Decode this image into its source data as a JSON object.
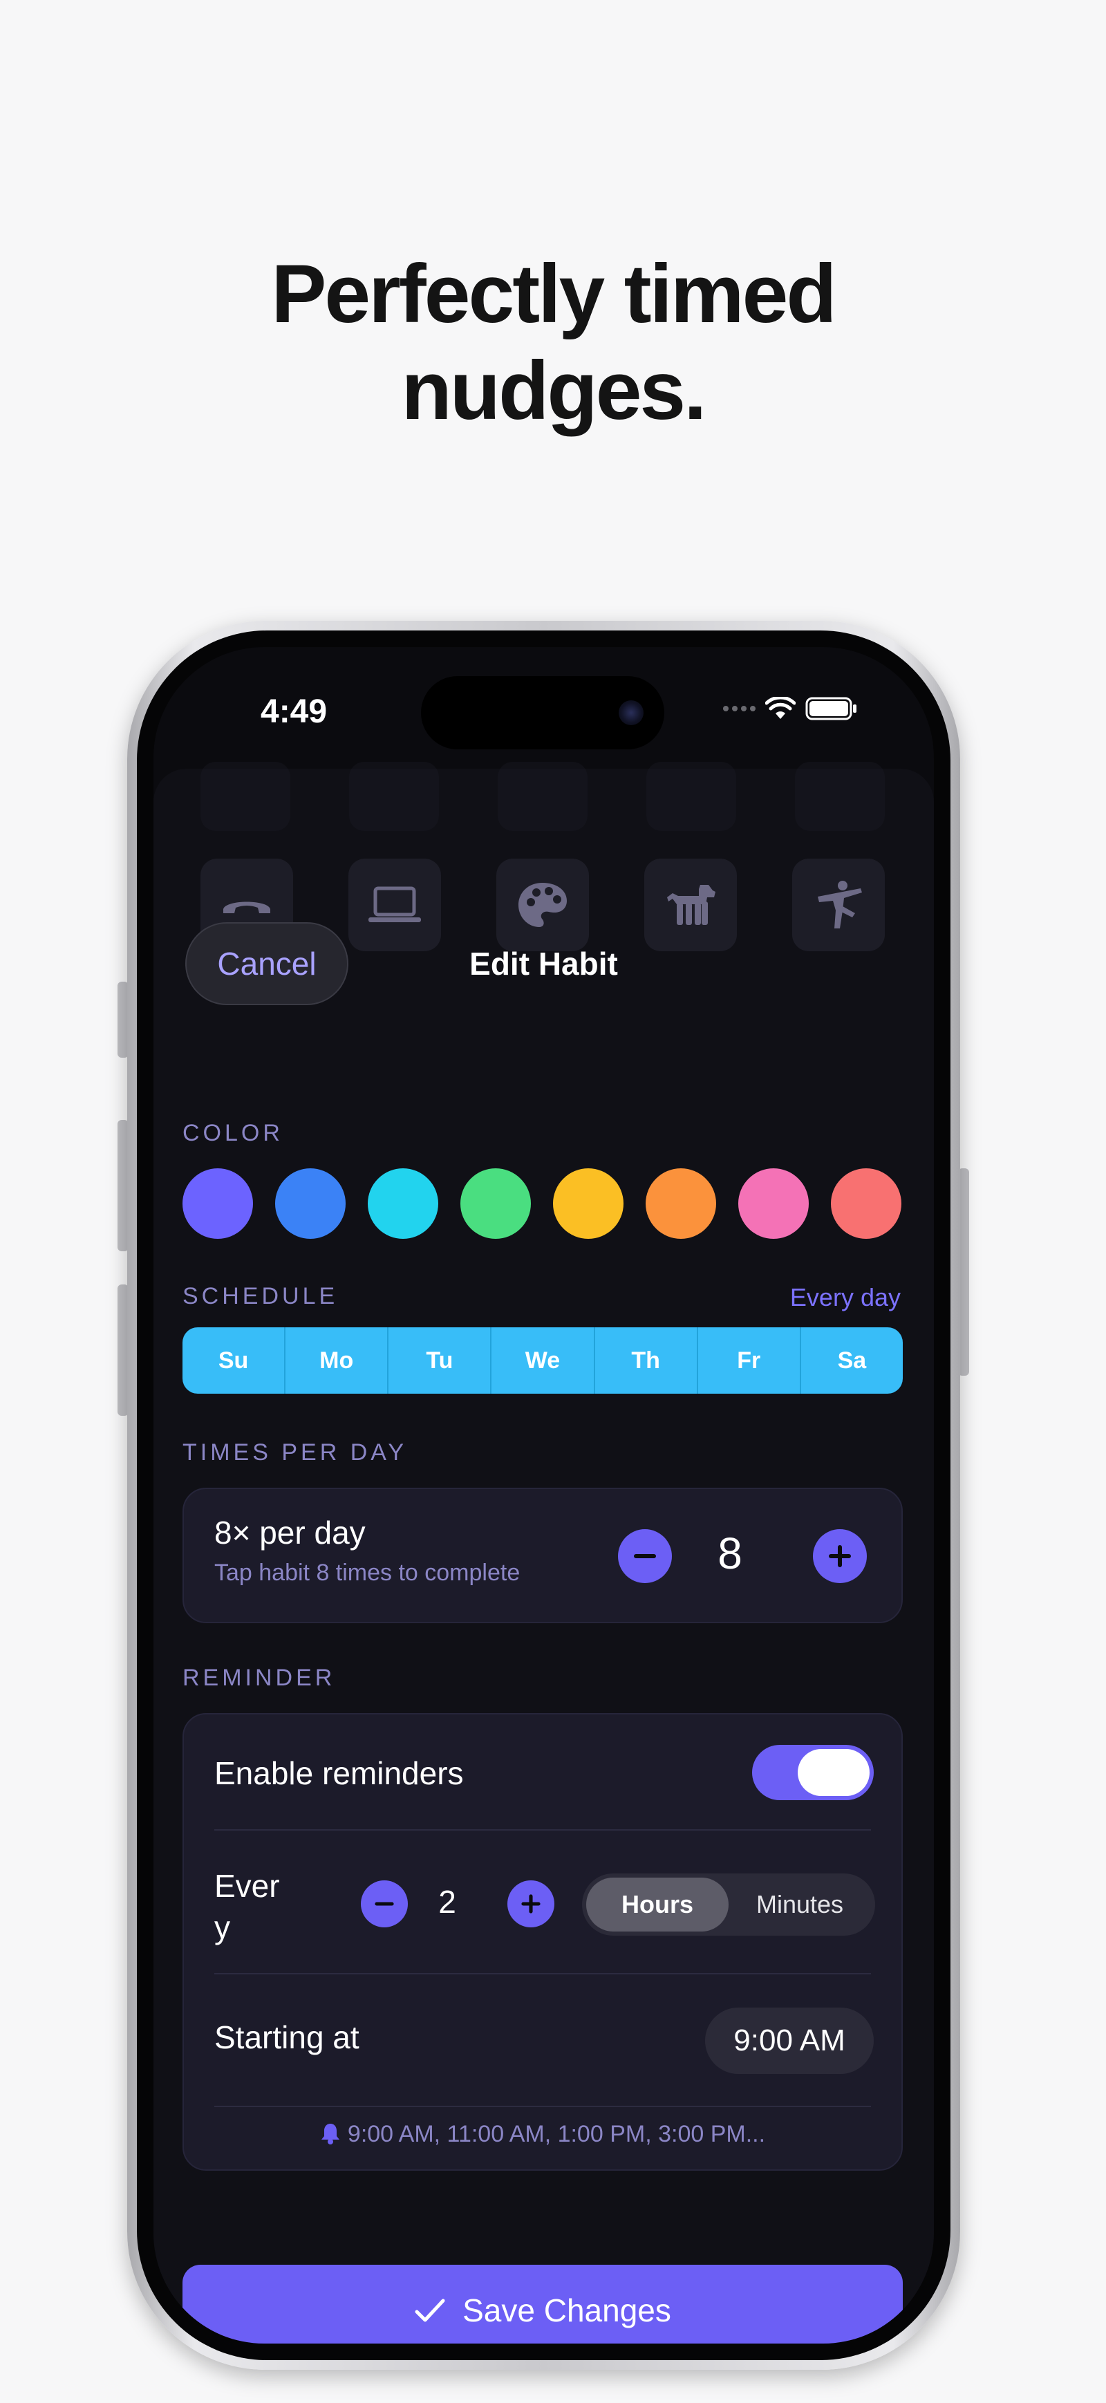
{
  "headline": {
    "line1": "Perfectly timed",
    "line2": "nudges."
  },
  "status_bar": {
    "time": "4:49"
  },
  "nav": {
    "cancel_label": "Cancel",
    "title": "Edit Habit"
  },
  "icons": [
    "phone-icon",
    "laptop-icon",
    "palette-icon",
    "dog-icon",
    "yoga-icon"
  ],
  "color_section": {
    "label": "COLOR",
    "swatches": [
      "#6c63ff",
      "#3b82f6",
      "#22d3ee",
      "#4ade80",
      "#fbbf24",
      "#fb923c",
      "#f472b6",
      "#f87171"
    ]
  },
  "schedule": {
    "label": "SCHEDULE",
    "summary": "Every day",
    "days": [
      "Su",
      "Mo",
      "Tu",
      "We",
      "Th",
      "Fr",
      "Sa"
    ]
  },
  "times_per_day": {
    "label": "TIMES PER DAY",
    "title": "8× per day",
    "subtitle": "Tap habit 8 times to complete",
    "value": "8"
  },
  "reminder": {
    "label": "REMINDER",
    "enable_label": "Enable reminders",
    "enabled": true,
    "every_label": "Ever\ny",
    "interval_value": "2",
    "units": [
      "Hours",
      "Minutes"
    ],
    "selected_unit": "Hours",
    "starting_label": "Starting at",
    "start_time": "9:00 AM",
    "preview": "9:00 AM, 11:00 AM, 1:00 PM, 3:00 PM..."
  },
  "save_button": {
    "label": "Save Changes"
  },
  "colors": {
    "accent": "#6c5ff5",
    "schedule": "#38bdf8",
    "sheet": "#101016",
    "card": "#1c1b2a"
  }
}
